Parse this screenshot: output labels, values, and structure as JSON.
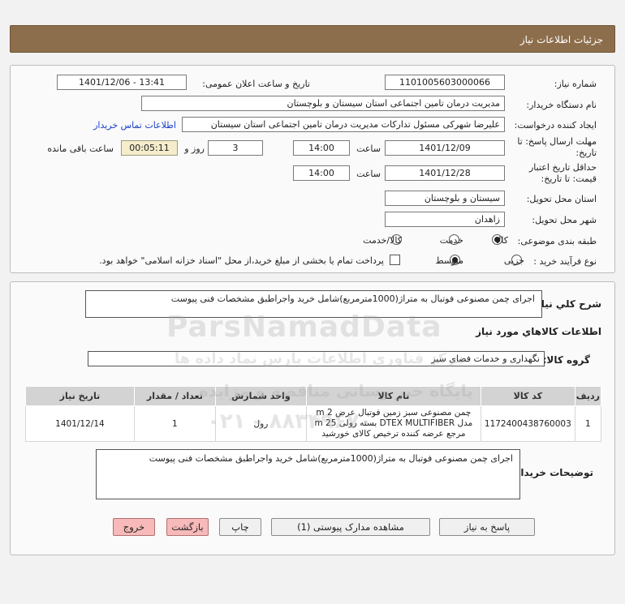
{
  "header": {
    "title": "جزئیات اطلاعات نیاز"
  },
  "form": {
    "need_number_label": "شماره نیاز:",
    "need_number": "1101005603000066",
    "announce_label": "تاریخ و ساعت اعلان عمومی:",
    "announce_value": "1401/12/06 - 13:41",
    "buyer_org_label": "نام دستگاه خریدار:",
    "buyer_org": "مدیریت درمان تامین اجتماعی استان سیستان و بلوچستان",
    "requester_label": "ایجاد کننده درخواست:",
    "requester": "علیرضا شهرکی مسئول تدارکات مدیریت درمان تامین اجتماعی استان سیستان",
    "contact_link": "اطلاعات تماس خریدار",
    "deadline_label_1": "مهلت ارسال پاسخ: تا",
    "deadline_label_2": "تاریخ:",
    "deadline_date": "1401/12/09",
    "time_label": "ساعت",
    "deadline_time": "14:00",
    "days_value": "3",
    "days_label": "روز و",
    "remaining_time": "00:05:11",
    "remaining_label": "ساعت باقی مانده",
    "validity_label_1": "حداقل تاریخ اعتبار",
    "validity_label_2": "قیمت: تا تاریخ:",
    "validity_date": "1401/12/28",
    "validity_time": "14:00",
    "province_label": "استان محل تحویل:",
    "province": "سیستان و بلوچستان",
    "city_label": "شهر محل تحویل:",
    "city": "زاهدان",
    "category_label": "طبقه بندی موضوعی:",
    "category_options": [
      "کالا",
      "خدمت",
      "کالا/خدمت"
    ],
    "process_label": "نوع فرآیند خرید :",
    "process_options": [
      "جزیی",
      "متوسط"
    ],
    "payment_note": "پرداخت تمام یا بخشی از مبلغ خرید،از محل \"اسناد خزانه اسلامی\" خواهد بود."
  },
  "details": {
    "summary_label": "شرح کلي نياز:",
    "summary": "اجرای چمن مصنوعی فوتبال به متراژ(1000مترمربع)شامل خرید واجراطبق مشخصات فنی پیوست",
    "goods_info_title": "اطلاعات کالاهاي مورد نياز",
    "goods_group_label": "گروه کالا:",
    "goods_group": "نگهداری و خدمات فضای سبز",
    "table": {
      "headers": [
        "ردیف",
        "کد کالا",
        "نام کالا",
        "واحد شمارش",
        "تعداد / مقدار",
        "تاریخ نیاز"
      ],
      "rows": [
        {
          "index": "1",
          "code": "1172400438760003",
          "name": "چمن مصنوعی سبز زمین فوتبال عرض 2 m مدل DTEX MULTIFIBER بسته رولی 25 m مرجع عرضه کننده ترخیص کالای خورشید",
          "unit": "رول",
          "qty": "1",
          "date": "1401/12/14"
        }
      ]
    },
    "buyer_notes_label": "توضیحات خریدار:",
    "buyer_notes": "اجرای چمن مصنوعی فوتبال به متراژ(1000مترمربع)شامل خرید واجراطبق مشخصات فنی پیوست"
  },
  "buttons": {
    "reply": "پاسخ به نیاز",
    "attachments": "مشاهده مدارک پیوستی (1)",
    "print": "چاپ",
    "back": "بازگشت",
    "exit": "خروج"
  },
  "watermark": {
    "brand": "ParsNamadData",
    "line1": "پایگاه خبر رسانی مناقصه و مزایده",
    "line2": "مرکز فناوری اطلاعات پارس نماد داده ها",
    "phone": "۰۲۱ - ۸۸۳۴۹۶۷۰"
  },
  "colors": {
    "header": "#8d6e4c",
    "link": "#1a3fc7",
    "exit_button": "#f7b9b9",
    "remaining_bg": "#f4eccb"
  }
}
